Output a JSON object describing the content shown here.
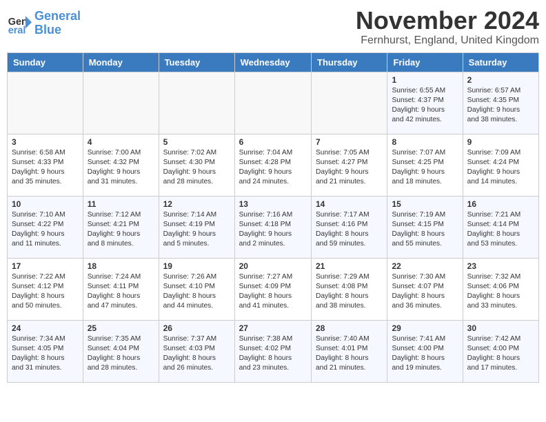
{
  "logo": {
    "general": "General",
    "blue": "Blue"
  },
  "title": "November 2024",
  "location": "Fernhurst, England, United Kingdom",
  "weekdays": [
    "Sunday",
    "Monday",
    "Tuesday",
    "Wednesday",
    "Thursday",
    "Friday",
    "Saturday"
  ],
  "weeks": [
    [
      {
        "day": "",
        "info": ""
      },
      {
        "day": "",
        "info": ""
      },
      {
        "day": "",
        "info": ""
      },
      {
        "day": "",
        "info": ""
      },
      {
        "day": "",
        "info": ""
      },
      {
        "day": "1",
        "info": "Sunrise: 6:55 AM\nSunset: 4:37 PM\nDaylight: 9 hours\nand 42 minutes."
      },
      {
        "day": "2",
        "info": "Sunrise: 6:57 AM\nSunset: 4:35 PM\nDaylight: 9 hours\nand 38 minutes."
      }
    ],
    [
      {
        "day": "3",
        "info": "Sunrise: 6:58 AM\nSunset: 4:33 PM\nDaylight: 9 hours\nand 35 minutes."
      },
      {
        "day": "4",
        "info": "Sunrise: 7:00 AM\nSunset: 4:32 PM\nDaylight: 9 hours\nand 31 minutes."
      },
      {
        "day": "5",
        "info": "Sunrise: 7:02 AM\nSunset: 4:30 PM\nDaylight: 9 hours\nand 28 minutes."
      },
      {
        "day": "6",
        "info": "Sunrise: 7:04 AM\nSunset: 4:28 PM\nDaylight: 9 hours\nand 24 minutes."
      },
      {
        "day": "7",
        "info": "Sunrise: 7:05 AM\nSunset: 4:27 PM\nDaylight: 9 hours\nand 21 minutes."
      },
      {
        "day": "8",
        "info": "Sunrise: 7:07 AM\nSunset: 4:25 PM\nDaylight: 9 hours\nand 18 minutes."
      },
      {
        "day": "9",
        "info": "Sunrise: 7:09 AM\nSunset: 4:24 PM\nDaylight: 9 hours\nand 14 minutes."
      }
    ],
    [
      {
        "day": "10",
        "info": "Sunrise: 7:10 AM\nSunset: 4:22 PM\nDaylight: 9 hours\nand 11 minutes."
      },
      {
        "day": "11",
        "info": "Sunrise: 7:12 AM\nSunset: 4:21 PM\nDaylight: 9 hours\nand 8 minutes."
      },
      {
        "day": "12",
        "info": "Sunrise: 7:14 AM\nSunset: 4:19 PM\nDaylight: 9 hours\nand 5 minutes."
      },
      {
        "day": "13",
        "info": "Sunrise: 7:16 AM\nSunset: 4:18 PM\nDaylight: 9 hours\nand 2 minutes."
      },
      {
        "day": "14",
        "info": "Sunrise: 7:17 AM\nSunset: 4:16 PM\nDaylight: 8 hours\nand 59 minutes."
      },
      {
        "day": "15",
        "info": "Sunrise: 7:19 AM\nSunset: 4:15 PM\nDaylight: 8 hours\nand 55 minutes."
      },
      {
        "day": "16",
        "info": "Sunrise: 7:21 AM\nSunset: 4:14 PM\nDaylight: 8 hours\nand 53 minutes."
      }
    ],
    [
      {
        "day": "17",
        "info": "Sunrise: 7:22 AM\nSunset: 4:12 PM\nDaylight: 8 hours\nand 50 minutes."
      },
      {
        "day": "18",
        "info": "Sunrise: 7:24 AM\nSunset: 4:11 PM\nDaylight: 8 hours\nand 47 minutes."
      },
      {
        "day": "19",
        "info": "Sunrise: 7:26 AM\nSunset: 4:10 PM\nDaylight: 8 hours\nand 44 minutes."
      },
      {
        "day": "20",
        "info": "Sunrise: 7:27 AM\nSunset: 4:09 PM\nDaylight: 8 hours\nand 41 minutes."
      },
      {
        "day": "21",
        "info": "Sunrise: 7:29 AM\nSunset: 4:08 PM\nDaylight: 8 hours\nand 38 minutes."
      },
      {
        "day": "22",
        "info": "Sunrise: 7:30 AM\nSunset: 4:07 PM\nDaylight: 8 hours\nand 36 minutes."
      },
      {
        "day": "23",
        "info": "Sunrise: 7:32 AM\nSunset: 4:06 PM\nDaylight: 8 hours\nand 33 minutes."
      }
    ],
    [
      {
        "day": "24",
        "info": "Sunrise: 7:34 AM\nSunset: 4:05 PM\nDaylight: 8 hours\nand 31 minutes."
      },
      {
        "day": "25",
        "info": "Sunrise: 7:35 AM\nSunset: 4:04 PM\nDaylight: 8 hours\nand 28 minutes."
      },
      {
        "day": "26",
        "info": "Sunrise: 7:37 AM\nSunset: 4:03 PM\nDaylight: 8 hours\nand 26 minutes."
      },
      {
        "day": "27",
        "info": "Sunrise: 7:38 AM\nSunset: 4:02 PM\nDaylight: 8 hours\nand 23 minutes."
      },
      {
        "day": "28",
        "info": "Sunrise: 7:40 AM\nSunset: 4:01 PM\nDaylight: 8 hours\nand 21 minutes."
      },
      {
        "day": "29",
        "info": "Sunrise: 7:41 AM\nSunset: 4:00 PM\nDaylight: 8 hours\nand 19 minutes."
      },
      {
        "day": "30",
        "info": "Sunrise: 7:42 AM\nSunset: 4:00 PM\nDaylight: 8 hours\nand 17 minutes."
      }
    ]
  ]
}
